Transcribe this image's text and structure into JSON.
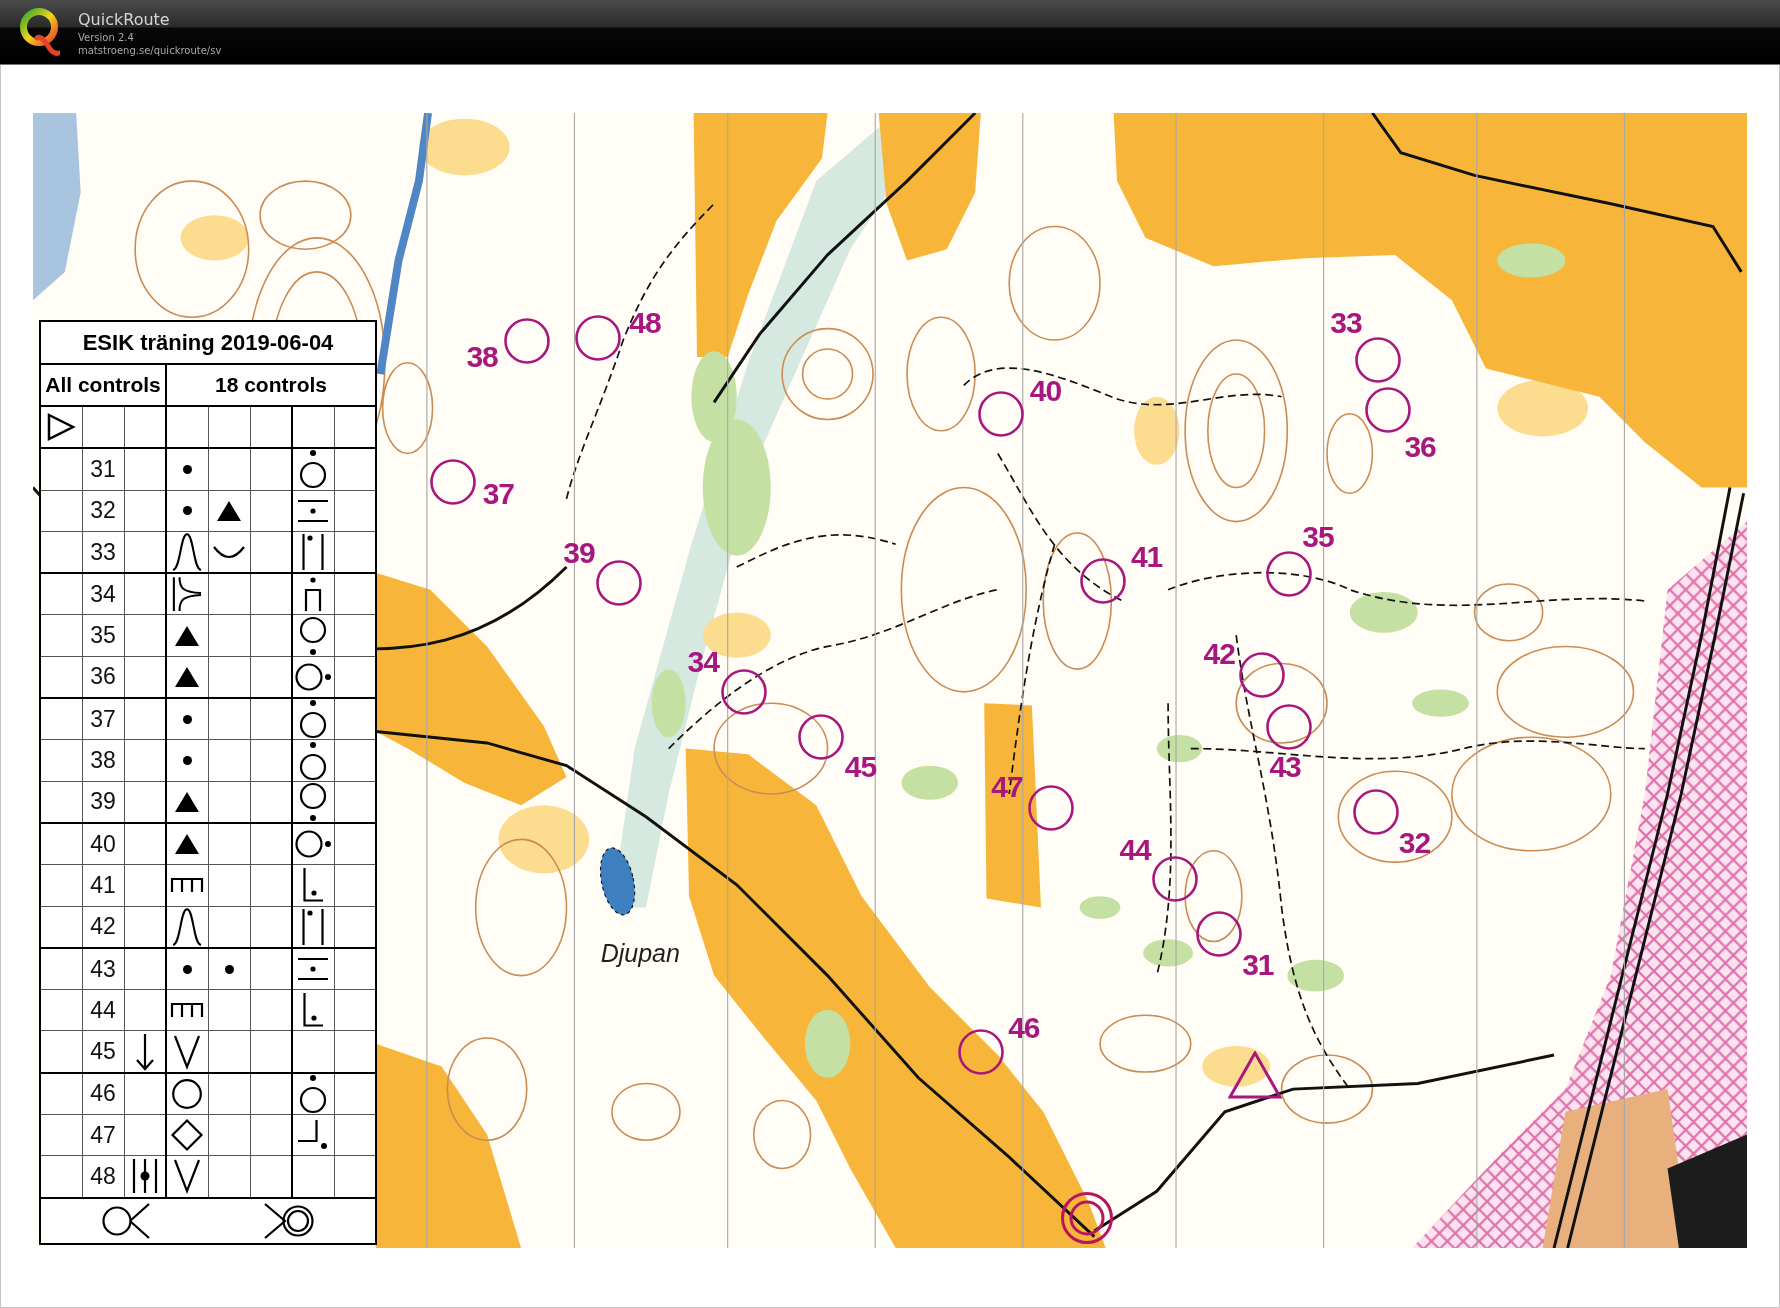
{
  "window": {
    "title": "QuickRoute",
    "version": "Version 2.4",
    "url": "matstroeng.se/quickroute/sv"
  },
  "description_sheet": {
    "title": "ESIK träning 2019-06-04",
    "header_left": "All controls",
    "header_right": "18 controls",
    "rows": [
      {
        "code": "31",
        "feature": {
          "kind": "dot"
        },
        "location": {
          "kind": "dotabove"
        }
      },
      {
        "code": "32",
        "feature": {
          "kind": "dot"
        },
        "appearance": {
          "kind": "triangle"
        },
        "location": {
          "kind": "linesdot"
        }
      },
      {
        "code": "33",
        "feature": {
          "kind": "bell"
        },
        "appearance": {
          "kind": "arc"
        },
        "location": {
          "kind": "barsdot"
        }
      },
      {
        "code": "34",
        "feature": {
          "kind": "fork"
        },
        "location": {
          "kind": "gatedot"
        }
      },
      {
        "code": "35",
        "feature": {
          "kind": "triangle"
        },
        "location": {
          "kind": "dotbelow"
        }
      },
      {
        "code": "36",
        "feature": {
          "kind": "triangle"
        },
        "location": {
          "kind": "dotright"
        }
      },
      {
        "code": "37",
        "feature": {
          "kind": "dot"
        },
        "location": {
          "kind": "dotabove"
        }
      },
      {
        "code": "38",
        "feature": {
          "kind": "dot"
        },
        "location": {
          "kind": "dotabove"
        }
      },
      {
        "code": "39",
        "feature": {
          "kind": "triangle"
        },
        "location": {
          "kind": "dotbelow"
        }
      },
      {
        "code": "40",
        "feature": {
          "kind": "triangle"
        },
        "location": {
          "kind": "dotright"
        }
      },
      {
        "code": "41",
        "feature": {
          "kind": "comb"
        },
        "location": {
          "kind": "corner"
        }
      },
      {
        "code": "42",
        "feature": {
          "kind": "bell"
        },
        "location": {
          "kind": "barsdot"
        }
      },
      {
        "code": "43",
        "feature": {
          "kind": "dot"
        },
        "appearance": {
          "kind": "dot"
        },
        "location": {
          "kind": "linesdot"
        }
      },
      {
        "code": "44",
        "feature": {
          "kind": "comb"
        },
        "location": {
          "kind": "corner"
        }
      },
      {
        "code": "45",
        "which": {
          "kind": "arrow"
        },
        "feature": {
          "kind": "v"
        }
      },
      {
        "code": "46",
        "feature": {
          "kind": "circle"
        },
        "location": {
          "kind": "dotabove"
        }
      },
      {
        "code": "47",
        "feature": {
          "kind": "diamond"
        },
        "location": {
          "kind": "cornerright"
        }
      },
      {
        "code": "48",
        "which": {
          "kind": "bardot"
        },
        "feature": {
          "kind": "v"
        }
      }
    ]
  },
  "map": {
    "controls": [
      {
        "number": "31"
      },
      {
        "number": "32"
      },
      {
        "number": "33"
      },
      {
        "number": "34"
      },
      {
        "number": "35"
      },
      {
        "number": "36"
      },
      {
        "number": "37"
      },
      {
        "number": "38"
      },
      {
        "number": "39"
      },
      {
        "number": "40"
      },
      {
        "number": "41"
      },
      {
        "number": "42"
      },
      {
        "number": "43"
      },
      {
        "number": "44"
      },
      {
        "number": "45"
      },
      {
        "number": "46"
      },
      {
        "number": "47"
      },
      {
        "number": "48"
      }
    ],
    "lake_name": "Djupan"
  }
}
